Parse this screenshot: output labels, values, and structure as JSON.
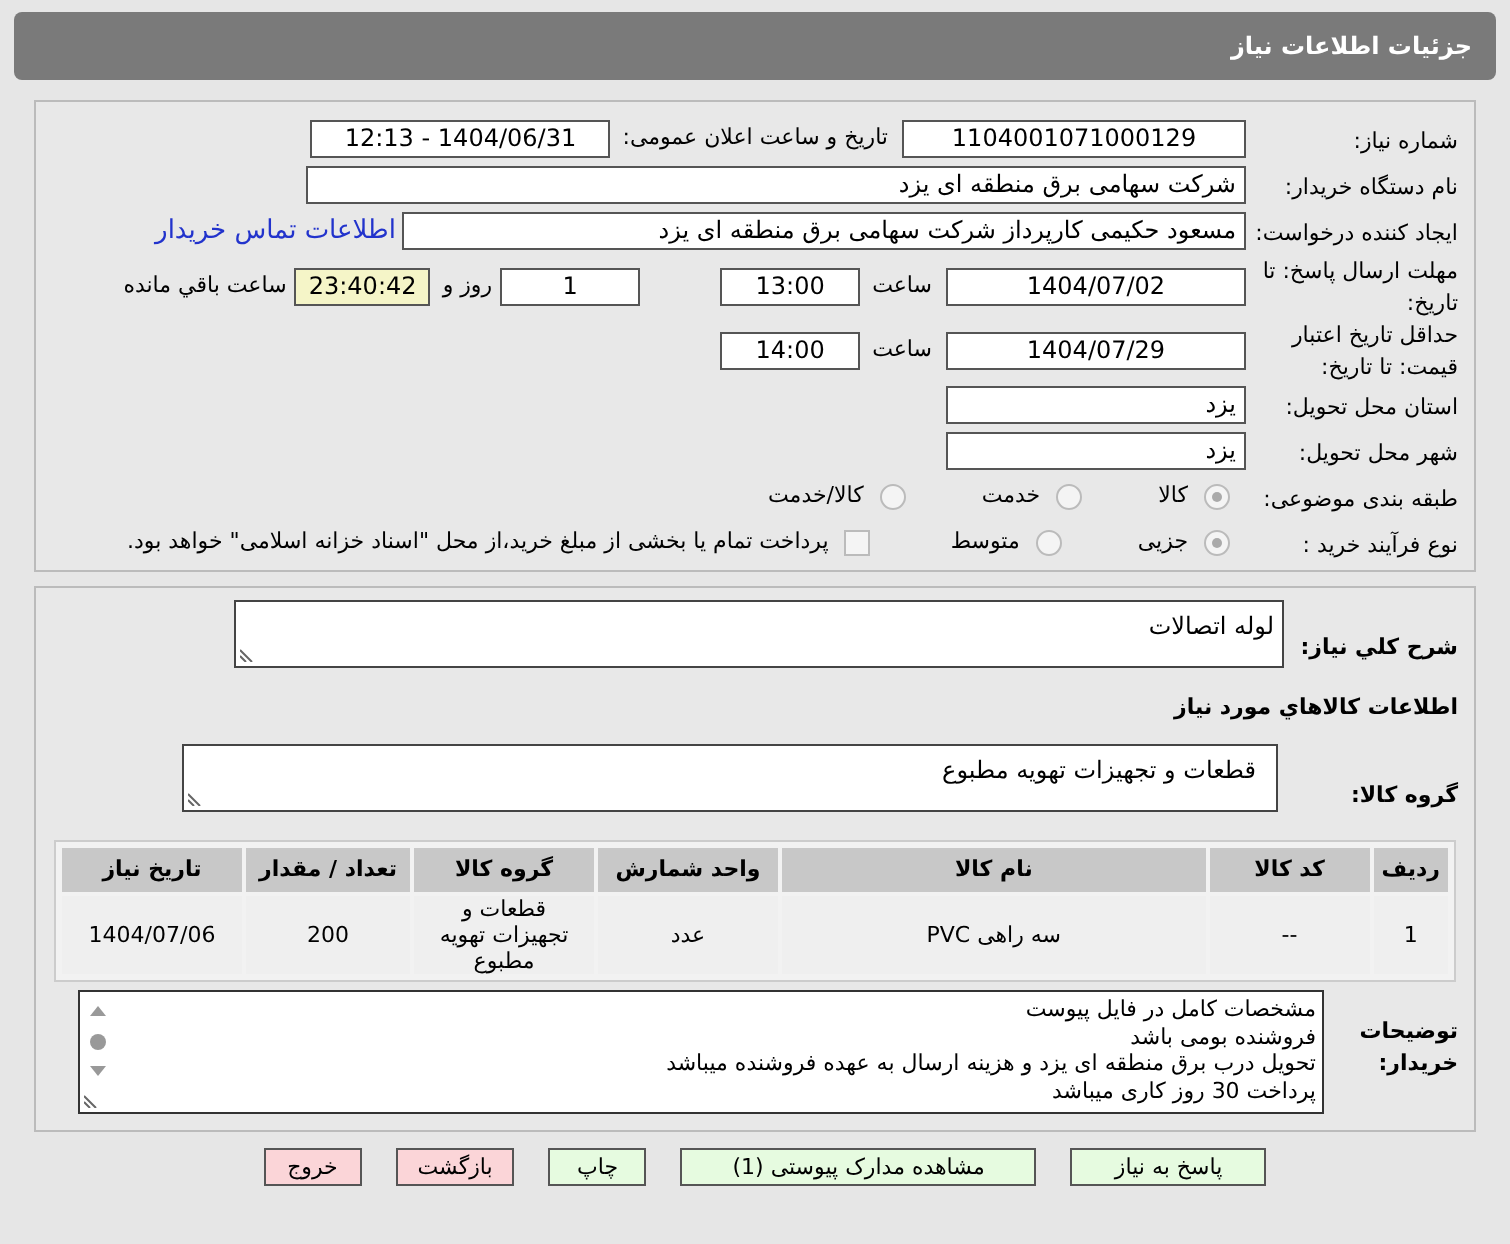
{
  "header": {
    "title": "جزئیات اطلاعات نیاز"
  },
  "need_number": {
    "label": "شماره نیاز:",
    "value": "1104001071000129"
  },
  "announce": {
    "label": "تاریخ و ساعت اعلان عمومی:",
    "value": "1404/06/31 - 12:13"
  },
  "buyer": {
    "label": "نام دستگاه خریدار:",
    "value": "شرکت سهامی برق منطقه ای یزد"
  },
  "creator": {
    "label": "ایجاد کننده درخواست:",
    "value": "مسعود حکیمی کارپرداز شرکت سهامی برق منطقه ای یزد",
    "link": "اطلاعات تماس خریدار"
  },
  "deadline": {
    "label": "مهلت ارسال پاسخ: تا تاریخ:",
    "date": "1404/07/02",
    "time_label": "ساعت",
    "time": "13:00",
    "days": "1",
    "days_label": "روز و",
    "remaining": "23:40:42",
    "remaining_label": "ساعت باقي مانده"
  },
  "validity": {
    "label": "حداقل تاریخ اعتبار قیمت: تا تاریخ:",
    "date": "1404/07/29",
    "time_label": "ساعت",
    "time": "14:00"
  },
  "province": {
    "label": "استان محل تحویل:",
    "value": "یزد"
  },
  "city": {
    "label": "شهر محل تحویل:",
    "value": "یزد"
  },
  "category": {
    "label": "طبقه بندی موضوعی:",
    "options": [
      {
        "label": "کالا",
        "selected": true
      },
      {
        "label": "خدمت",
        "selected": false
      },
      {
        "label": "کالا/خدمت",
        "selected": false
      }
    ]
  },
  "purchase_type": {
    "label": "نوع فرآیند خرید :",
    "options": [
      {
        "label": "جزیی",
        "selected": true
      },
      {
        "label": "متوسط",
        "selected": false
      }
    ],
    "treasury": {
      "checked": false,
      "text": "پرداخت تمام یا بخشی از مبلغ خرید،از محل \"اسناد خزانه اسلامی\" خواهد بود."
    }
  },
  "description": {
    "label": "شرح کلي نياز:",
    "value": "لوله اتصالات"
  },
  "goods_heading": "اطلاعات کالاهاي مورد نياز",
  "goods_group": {
    "label": "گروه کالا:",
    "value": "قطعات و تجهیزات تهویه مطبوع"
  },
  "table": {
    "columns": [
      "رديف",
      "کد کالا",
      "نام کالا",
      "واحد شمارش",
      "گروه کالا",
      "تعداد / مقدار",
      "تاریخ نیاز"
    ],
    "rows": [
      [
        "1",
        "--",
        "سه راهی PVC",
        "عدد",
        "قطعات و تجهیزات تهویه مطبوع",
        "200",
        "1404/07/06"
      ]
    ]
  },
  "notes": {
    "label": "توضیحات خریدار:",
    "lines": [
      "مشخصات کامل در فایل پیوست",
      "فروشنده بومی باشد",
      "تحویل درب برق منطقه ای یزد و هزینه ارسال به عهده فروشنده میباشد",
      "پرداخت 30 روز کاری میباشد"
    ]
  },
  "buttons": [
    {
      "label": "پاسخ به نیاز",
      "kind": "green"
    },
    {
      "label": "مشاهده مدارک پیوستی (1)",
      "kind": "green"
    },
    {
      "label": "چاپ",
      "kind": "green"
    },
    {
      "label": "بازگشت",
      "kind": "red"
    },
    {
      "label": "خروج",
      "kind": "red"
    }
  ]
}
